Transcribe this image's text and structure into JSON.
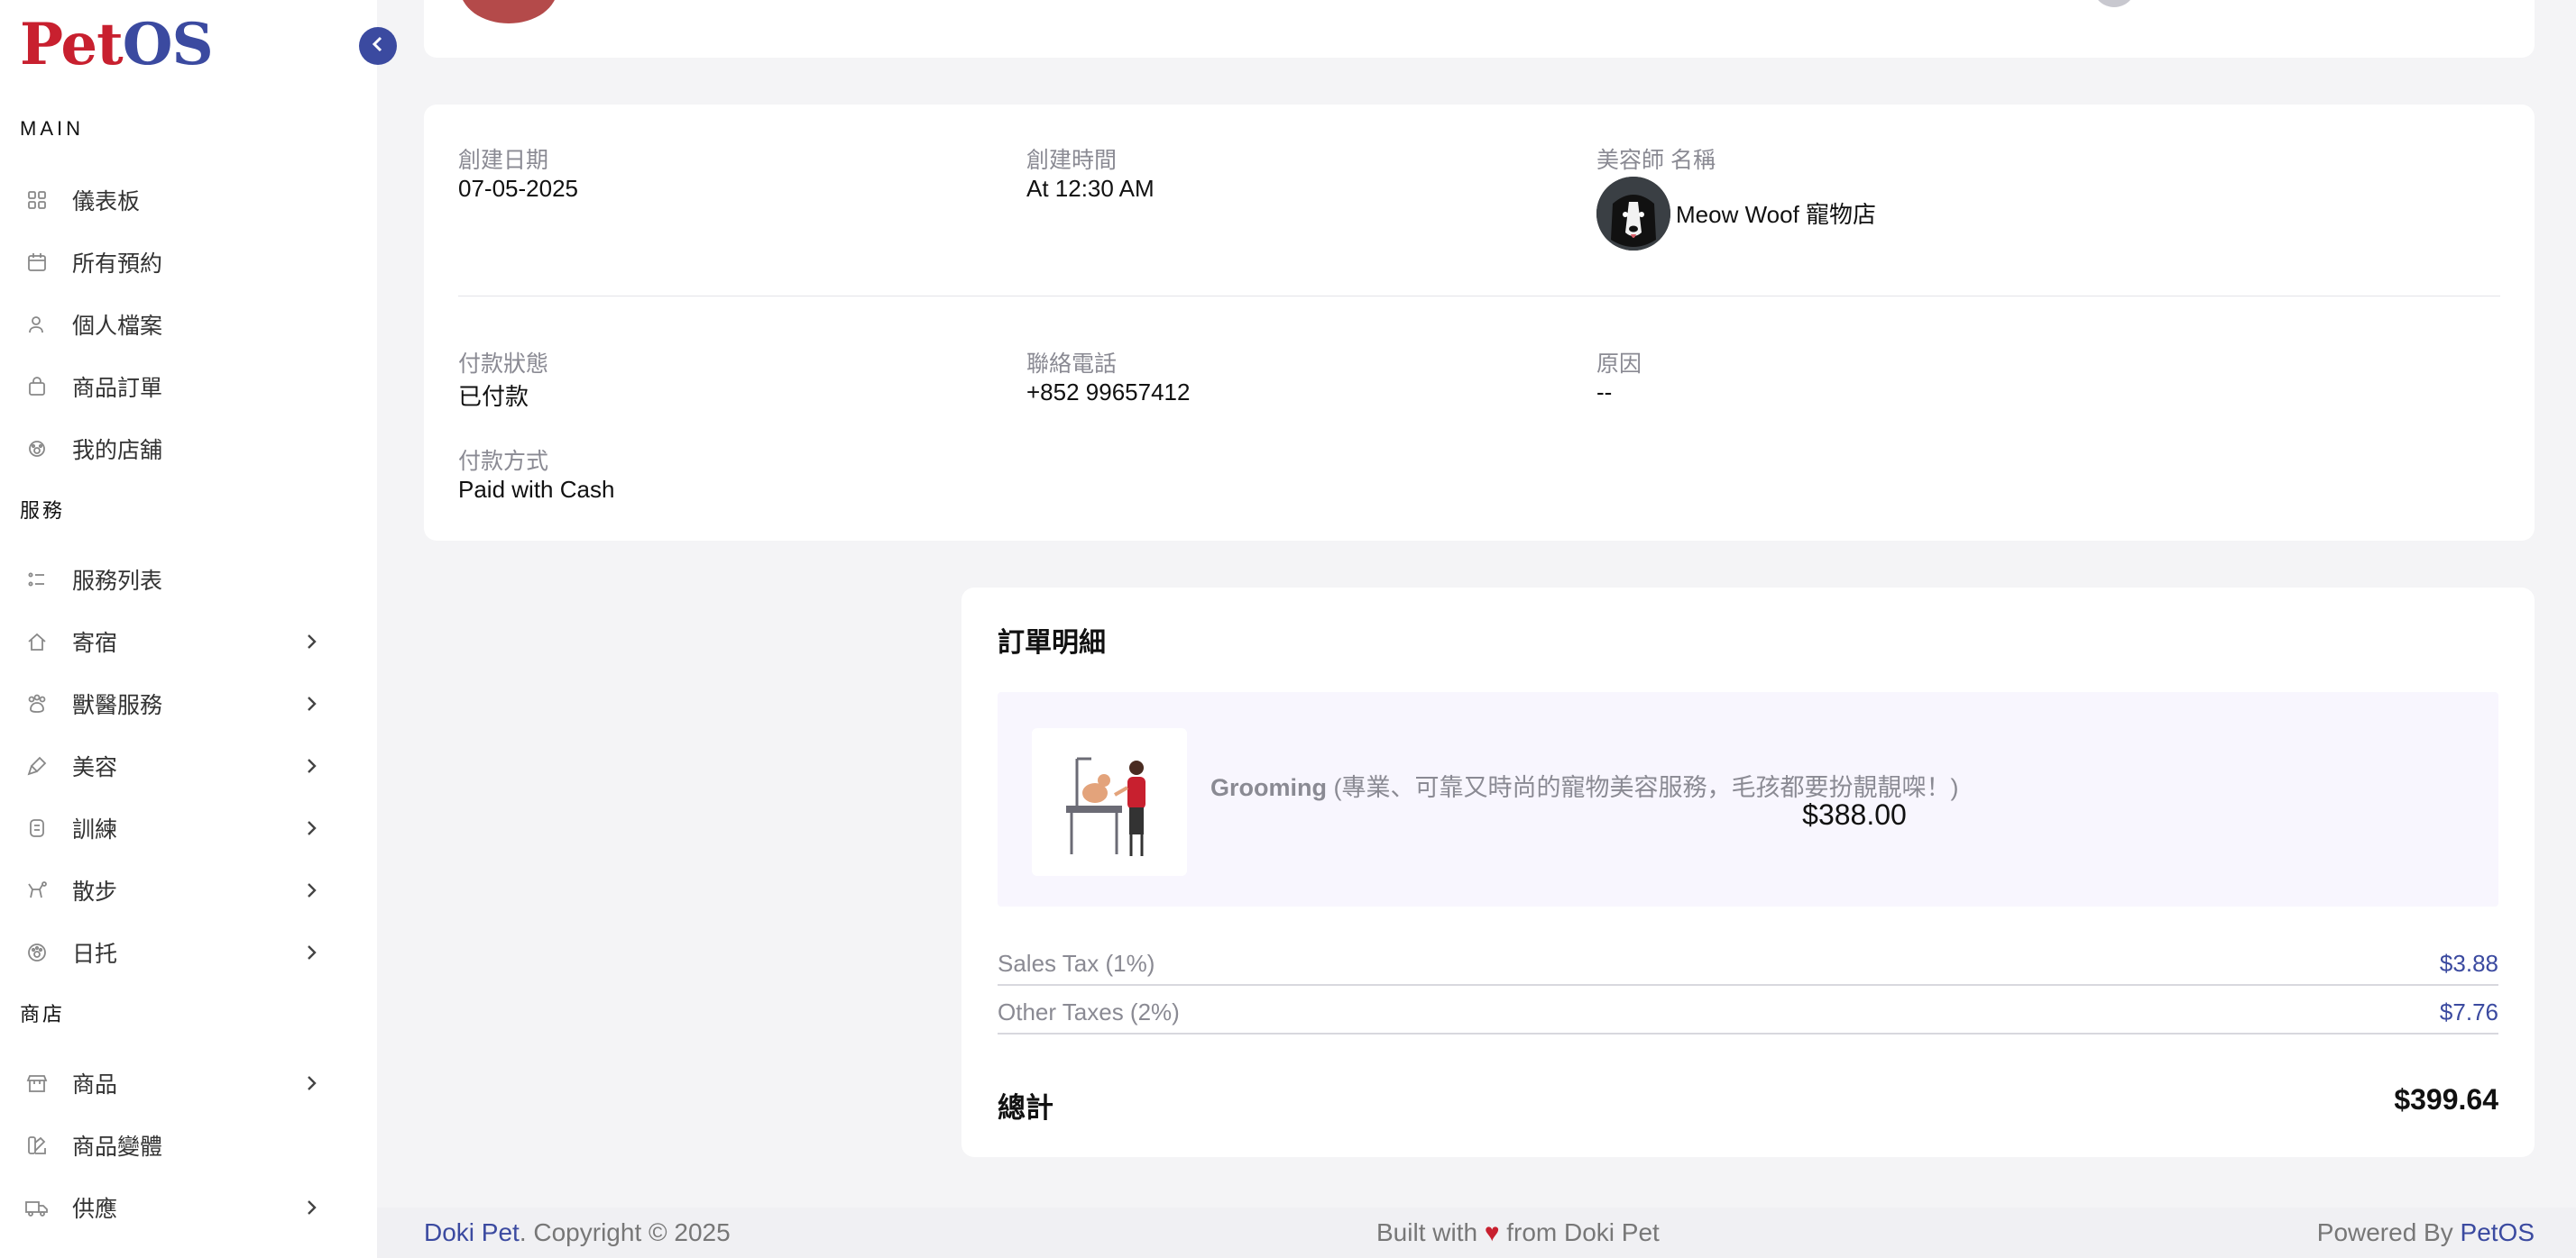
{
  "app": {
    "logo_part1": "Pet",
    "logo_part2": "OS"
  },
  "sidebar": {
    "sections": [
      {
        "label": "MAIN"
      },
      {
        "label": "服務"
      },
      {
        "label": "商店"
      }
    ],
    "items": [
      {
        "label": "儀表板",
        "icon": "grid-icon"
      },
      {
        "label": "所有預約",
        "icon": "calendar-icon"
      },
      {
        "label": "個人檔案",
        "icon": "user-icon"
      },
      {
        "label": "商品訂單",
        "icon": "bag-icon"
      },
      {
        "label": "我的店舖",
        "icon": "paw-icon"
      },
      {
        "label": "服務列表",
        "icon": "list-icon"
      },
      {
        "label": "寄宿",
        "icon": "home-icon"
      },
      {
        "label": "獸醫服務",
        "icon": "vet-icon"
      },
      {
        "label": "美容",
        "icon": "brush-icon"
      },
      {
        "label": "訓練",
        "icon": "medal-icon"
      },
      {
        "label": "散步",
        "icon": "walk-icon"
      },
      {
        "label": "日托",
        "icon": "gear-paw-icon"
      },
      {
        "label": "商品",
        "icon": "store-icon"
      },
      {
        "label": "商品變體",
        "icon": "variant-icon"
      },
      {
        "label": "供應",
        "icon": "truck-icon"
      }
    ]
  },
  "booking": {
    "created_date_label": "創建日期",
    "created_date": "07-05-2025",
    "created_time_label": "創建時間",
    "created_time": "At 12:30 AM",
    "groomer_label": "美容師 名稱",
    "groomer_name": "Meow Woof 寵物店",
    "payment_status_label": "付款狀態",
    "payment_status": "已付款",
    "phone_label": "聯絡電話",
    "phone": "+852 99657412",
    "reason_label": "原因",
    "reason": "--",
    "payment_method_label": "付款方式",
    "payment_method": "Paid with Cash"
  },
  "order": {
    "title": "訂單明細",
    "item_name": "Grooming",
    "item_desc": " (專業、可靠又時尚的寵物美容服務，毛孩都要扮靚靚㗎！)",
    "item_price": "$388.00",
    "taxes": [
      {
        "label": "Sales Tax (1%)",
        "value": "$3.88"
      },
      {
        "label": "Other Taxes (2%)",
        "value": "$7.76"
      }
    ],
    "total_label": "總計",
    "total_value": "$399.64"
  },
  "footer": {
    "brand": "Doki Pet",
    "copyright": ". Copyright © 2025",
    "built_prefix": "Built with ",
    "heart": "♥",
    "built_suffix": " from Doki Pet",
    "powered_prefix": "Powered By ",
    "powered_brand": "PetOS"
  },
  "colors": {
    "brand_blue": "#3b4aa0",
    "brand_red": "#c8202f"
  }
}
